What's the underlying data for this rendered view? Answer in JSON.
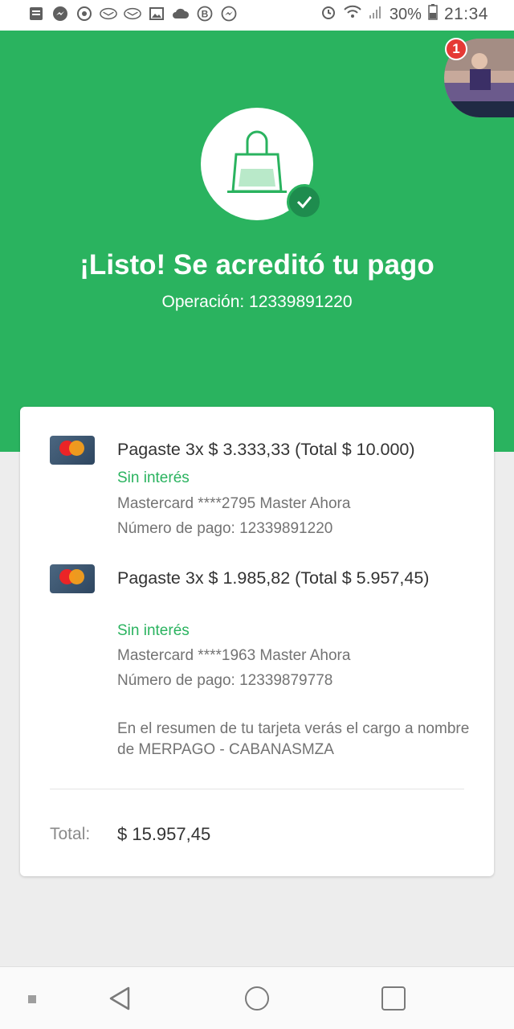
{
  "status_bar": {
    "battery": "30%",
    "time": "21:34",
    "left_icons": [
      "notes-icon",
      "messenger-icon",
      "whatsapp-icon",
      "mail-icon",
      "mail-icon",
      "gallery-icon",
      "cloud-icon",
      "b-icon",
      "messenger-icon"
    ],
    "right_icons": [
      "alarm-icon",
      "wifi-icon",
      "signal-icon",
      "battery-icon"
    ]
  },
  "header": {
    "title": "¡Listo! Se acreditó tu pago",
    "operation": "Operación: 12339891220",
    "notification_count": "1",
    "accent_color": "#2ab35f",
    "dark_green": "#1e8c4e"
  },
  "payments": [
    {
      "title": "Pagaste 3x $ 3.333,33 (Total $ 10.000)",
      "interest": "Sin interés",
      "card": "Mastercard ****2795 Master Ahora",
      "payment_number": "Número de pago: 12339891220",
      "card_brand": "mastercard"
    },
    {
      "title": "Pagaste 3x $ 1.985,82 (Total $ 5.957,45)",
      "interest": "Sin interés",
      "card": "Mastercard ****1963 Master Ahora",
      "payment_number": "Número de pago: 12339879778",
      "card_brand": "mastercard"
    }
  ],
  "summary_note": "En el resumen de tu tarjeta verás el cargo a nombre de MERPAGO - CABANASMZA",
  "total": {
    "label": "Total:",
    "value": "$ 15.957,45"
  },
  "nav_bar": {
    "icons": [
      "menu-dot-icon",
      "back-icon",
      "home-icon",
      "recents-icon"
    ]
  }
}
